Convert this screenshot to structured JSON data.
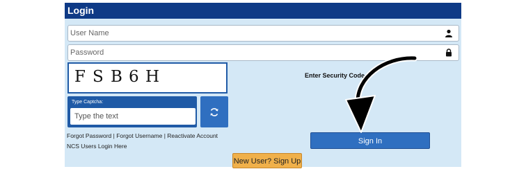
{
  "header": {
    "title": "Login"
  },
  "username": {
    "placeholder": "User Name",
    "icon": "user-icon"
  },
  "password": {
    "placeholder": "Password",
    "icon": "lock-icon"
  },
  "captcha": {
    "chars": [
      "F",
      "S",
      "B",
      "6",
      "H"
    ],
    "label": "Type Captcha:",
    "placeholder": "Type the text",
    "refresh_icon": "refresh-icon"
  },
  "security_code_label": "Enter Security Code",
  "links": {
    "forgot_password": "Forgot Password",
    "separator": " | ",
    "forgot_username": "Forgot Username",
    "reactivate": "Reactivate Account",
    "ncs_login": "NCS Users Login Here"
  },
  "buttons": {
    "sign_in": "Sign In",
    "sign_up": "New User? Sign Up"
  },
  "colors": {
    "header_bg": "#0e3a86",
    "panel_bg": "#d4e8f6",
    "accent_blue": "#2f6fc0",
    "signup_orange": "#f0b04a"
  }
}
